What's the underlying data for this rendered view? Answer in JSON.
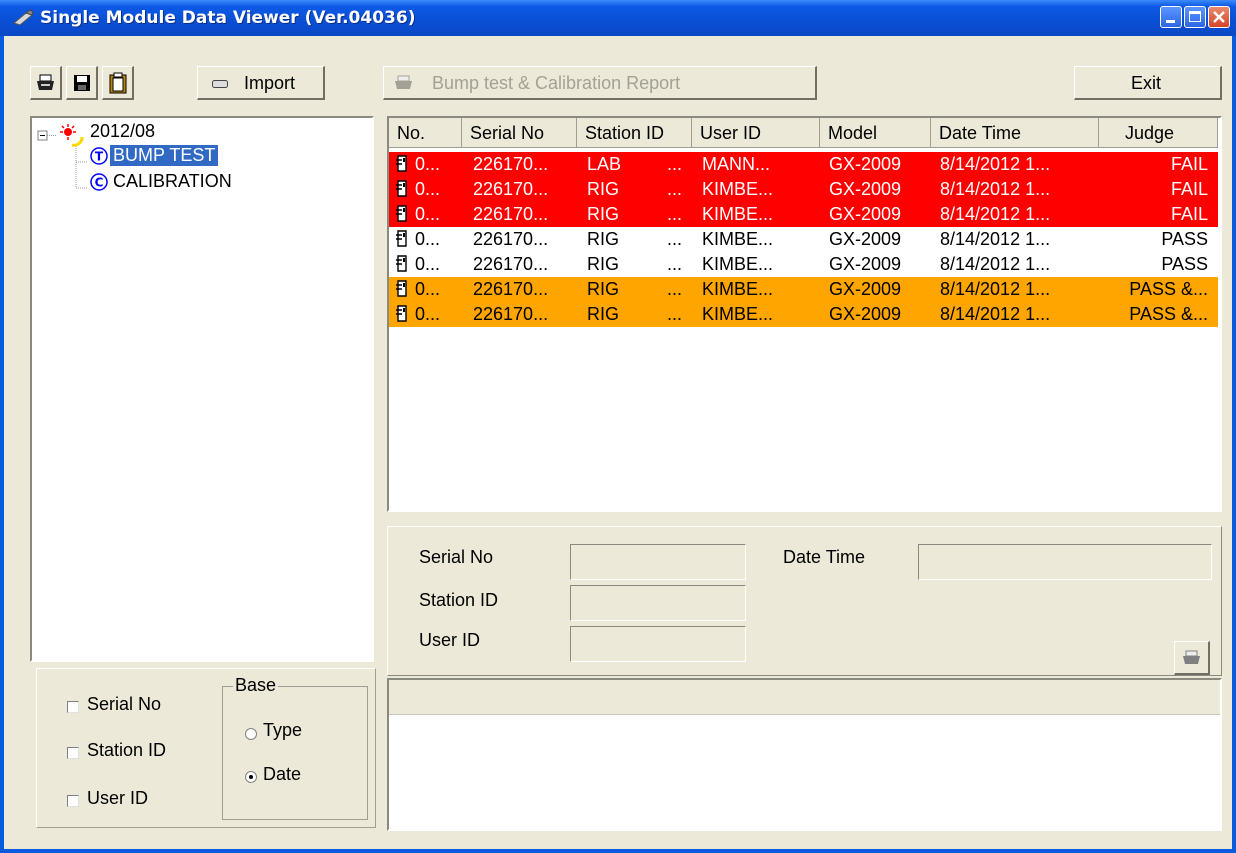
{
  "window": {
    "title": "Single Module Data Viewer (Ver.04036)",
    "controls": [
      "minimize",
      "maximize",
      "close"
    ]
  },
  "toolbar": {
    "print_icon": "printer-icon",
    "save_icon": "floppy-disk-icon",
    "clipboard_icon": "clipboard-icon",
    "import_label": "Import",
    "report_label": "Bump test & Calibration Report",
    "exit_label": "Exit"
  },
  "tree": {
    "root": "2012/08",
    "children": [
      {
        "badge": "T",
        "label": "BUMP TEST",
        "selected": true
      },
      {
        "badge": "C",
        "label": "CALIBRATION",
        "selected": false
      }
    ]
  },
  "filters": {
    "checkboxes": [
      "Serial No",
      "Station ID",
      "User ID"
    ],
    "base_label": "Base",
    "radios": [
      {
        "label": "Type",
        "checked": false
      },
      {
        "label": "Date",
        "checked": true
      }
    ]
  },
  "table": {
    "columns": [
      "No.",
      "Serial No",
      "Station ID",
      "User ID",
      "Model",
      "Date Time",
      "Judge"
    ],
    "rows": [
      {
        "no": "0...",
        "serial": "226170...",
        "station": "LAB",
        "dots": "...",
        "user": "MANN...",
        "model": "GX-2009",
        "datetime": "8/14/2012 1...",
        "judge": "FAIL",
        "status": "fail"
      },
      {
        "no": "0...",
        "serial": "226170...",
        "station": "RIG",
        "dots": "...",
        "user": "KIMBE...",
        "model": "GX-2009",
        "datetime": "8/14/2012 1...",
        "judge": "FAIL",
        "status": "fail"
      },
      {
        "no": "0...",
        "serial": "226170...",
        "station": "RIG",
        "dots": "...",
        "user": "KIMBE...",
        "model": "GX-2009",
        "datetime": "8/14/2012 1...",
        "judge": "FAIL",
        "status": "fail"
      },
      {
        "no": "0...",
        "serial": "226170...",
        "station": "RIG",
        "dots": "...",
        "user": "KIMBE...",
        "model": "GX-2009",
        "datetime": "8/14/2012 1...",
        "judge": "PASS",
        "status": "pass"
      },
      {
        "no": "0...",
        "serial": "226170...",
        "station": "RIG",
        "dots": "...",
        "user": "KIMBE...",
        "model": "GX-2009",
        "datetime": "8/14/2012 1...",
        "judge": "PASS",
        "status": "pass"
      },
      {
        "no": "0...",
        "serial": "226170...",
        "station": "RIG",
        "dots": "...",
        "user": "KIMBE...",
        "model": "GX-2009",
        "datetime": "8/14/2012 1...",
        "judge": "PASS &...",
        "status": "warn"
      },
      {
        "no": "0...",
        "serial": "226170...",
        "station": "RIG",
        "dots": "...",
        "user": "KIMBE...",
        "model": "GX-2009",
        "datetime": "8/14/2012 1...",
        "judge": "PASS &...",
        "status": "warn"
      }
    ]
  },
  "details": {
    "serial_label": "Serial No",
    "station_label": "Station ID",
    "user_label": "User ID",
    "datetime_label": "Date Time",
    "serial_value": "",
    "station_value": "",
    "user_value": "",
    "datetime_value": ""
  },
  "colors": {
    "fail": "#ff0000",
    "warn": "#ffa500",
    "selection": "#316ac5",
    "titlebar": "#0a4fd4"
  }
}
